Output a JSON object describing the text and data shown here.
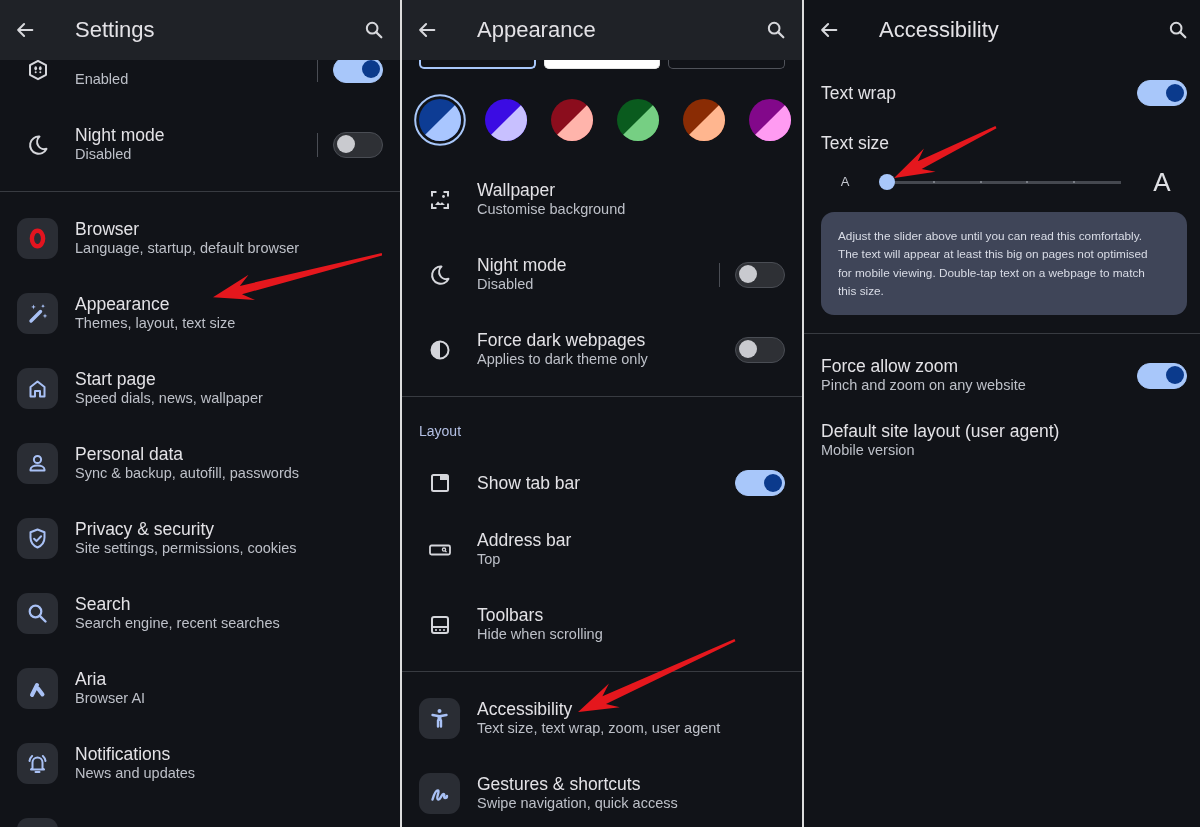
{
  "panels": [
    {
      "title": "Settings",
      "raised": true,
      "sections": [
        {
          "items": [
            {
              "kind": "combo",
              "subtitle": "Enabled",
              "on": true,
              "annotated": false
            },
            {
              "kind": "combo",
              "title": "Night mode",
              "subtitle": "Disabled",
              "on": false,
              "annotated": false
            }
          ]
        },
        {
          "items": [
            {
              "kind": "link",
              "title": "Browser",
              "subtitle": "Language, startup, default browser",
              "annotated": false
            },
            {
              "kind": "link",
              "title": "Appearance",
              "subtitle": "Themes, layout, text size",
              "annotated": true
            },
            {
              "kind": "link",
              "title": "Start page",
              "subtitle": "Speed dials, news, wallpaper",
              "annotated": false
            },
            {
              "kind": "link",
              "title": "Personal data",
              "subtitle": "Sync & backup, autofill, passwords",
              "annotated": false
            },
            {
              "kind": "link",
              "title": "Privacy & security",
              "subtitle": "Site settings, permissions, cookies",
              "annotated": false
            },
            {
              "kind": "link",
              "title": "Search",
              "subtitle": "Search engine, recent searches",
              "annotated": false
            },
            {
              "kind": "link",
              "title": "Aria",
              "subtitle": "Browser AI",
              "annotated": false
            },
            {
              "kind": "link",
              "title": "Notifications",
              "subtitle": "News and updates",
              "annotated": false
            },
            {
              "kind": "link",
              "annotated": false
            }
          ]
        }
      ]
    },
    {
      "title": "Appearance",
      "raised": true,
      "sections": [
        {
          "items": [
            {
              "kind": "themes",
              "annotated": false,
              "options": [
                {
                  "kind": "dark",
                  "selected": true
                },
                {
                  "kind": "light",
                  "selected": false
                },
                {
                  "kind": "dark",
                  "selected": false
                }
              ]
            },
            {
              "kind": "swatches",
              "annotated": false,
              "options": [
                {
                  "halves": [
                    {
                      "color": "#0d3c94"
                    },
                    {
                      "color": "#a9c6ff"
                    }
                  ],
                  "selected": true
                },
                {
                  "halves": [
                    {
                      "color": "#3b0ce3"
                    },
                    {
                      "color": "#c8c0ff"
                    }
                  ],
                  "selected": false
                },
                {
                  "halves": [
                    {
                      "color": "#8b0d1d"
                    },
                    {
                      "color": "#ffb4ab"
                    }
                  ],
                  "selected": false
                },
                {
                  "halves": [
                    {
                      "color": "#0a5b1e"
                    },
                    {
                      "color": "#76cf83"
                    }
                  ],
                  "selected": false
                },
                {
                  "halves": [
                    {
                      "color": "#8a2c04"
                    },
                    {
                      "color": "#ffb68f"
                    }
                  ],
                  "selected": false
                },
                {
                  "halves": [
                    {
                      "color": "#82088a"
                    },
                    {
                      "color": "#ff9bf2"
                    }
                  ],
                  "selected": false
                }
              ]
            },
            {
              "kind": "link",
              "title": "Wallpaper",
              "subtitle": "Customise background",
              "annotated": false
            },
            {
              "kind": "combo",
              "title": "Night mode",
              "subtitle": "Disabled",
              "on": false,
              "annotated": false
            },
            {
              "kind": "switch",
              "title": "Force dark webpages",
              "subtitle": "Applies to dark theme only",
              "on": false,
              "annotated": false
            }
          ]
        },
        {
          "heading": "Layout",
          "items": [
            {
              "kind": "switch",
              "title": "Show tab bar",
              "on": true,
              "annotated": false
            },
            {
              "kind": "link",
              "title": "Address bar",
              "subtitle": "Top",
              "annotated": false
            },
            {
              "kind": "link",
              "title": "Toolbars",
              "subtitle": "Hide when scrolling",
              "annotated": false
            }
          ]
        },
        {
          "items": [
            {
              "kind": "link",
              "title": "Accessibility",
              "subtitle": "Text size, text wrap, zoom, user agent",
              "annotated": true
            },
            {
              "kind": "link",
              "title": "Gestures & shortcuts",
              "subtitle": "Swipe navigation, quick access",
              "annotated": false
            }
          ]
        }
      ]
    },
    {
      "title": "Accessibility",
      "raised": false,
      "sections": [
        {
          "items": [
            {
              "kind": "switch",
              "title": "Text wrap",
              "on": true,
              "annotated": false
            },
            {
              "kind": "slider",
              "title": "Text size",
              "min_label": "A",
              "max_label": "A",
              "level": 0,
              "annotated": true
            },
            {
              "kind": "note",
              "text": "Adjust the slider above until you can read this comfortably. The text will appear at least this big on pages not optimised for mobile viewing. Double-tap text on a webpage to match this size.",
              "annotated": false
            }
          ]
        },
        {
          "items": [
            {
              "kind": "switch",
              "title": "Force allow zoom",
              "subtitle": "Pinch and zoom on any website",
              "on": true,
              "annotated": false
            },
            {
              "kind": "link",
              "title": "Default site layout (user agent)",
              "subtitle": "Mobile version",
              "annotated": false
            }
          ]
        }
      ]
    }
  ]
}
